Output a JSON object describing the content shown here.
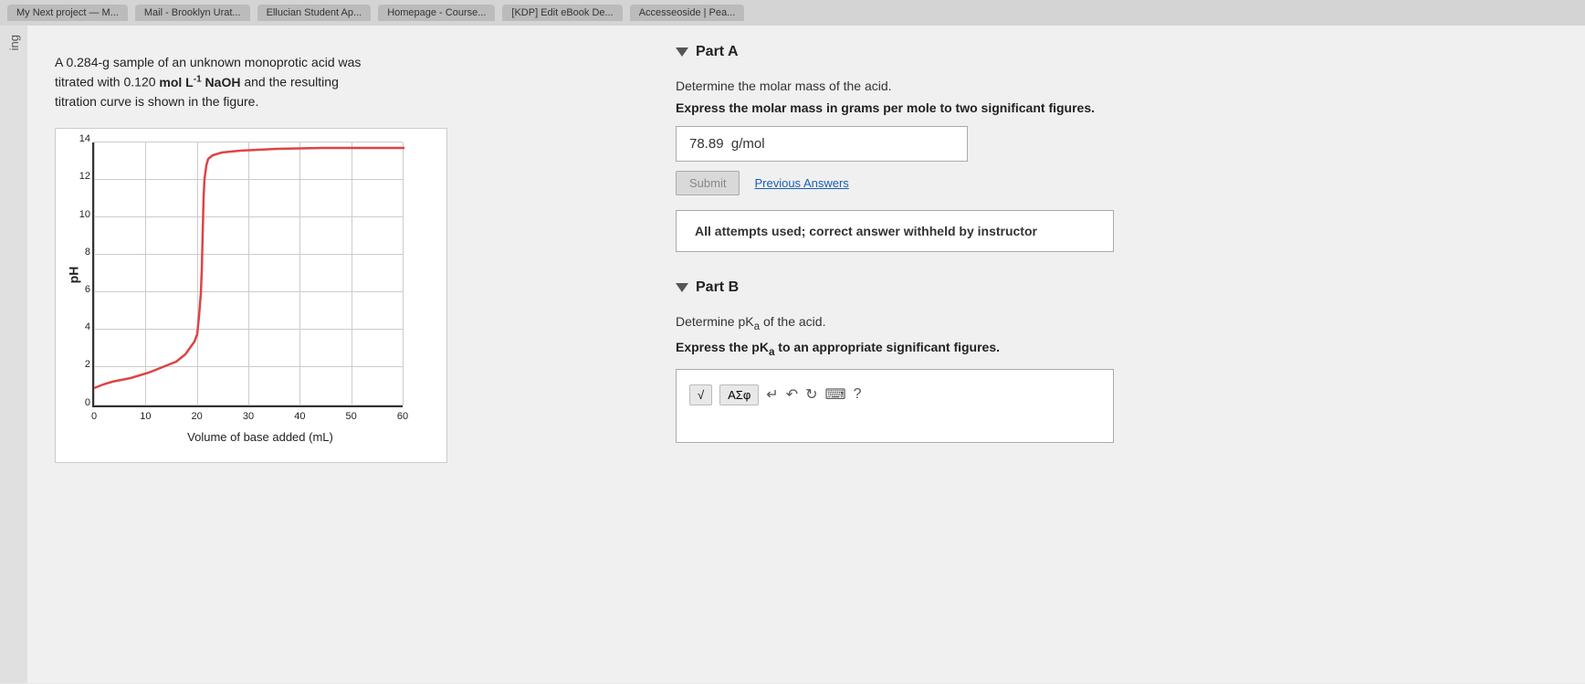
{
  "browser": {
    "tabs": [
      {
        "label": "My Next project — M...",
        "active": false
      },
      {
        "label": "Mail - Brooklyn Urat...",
        "active": false
      },
      {
        "label": "Ellucian Student Ap...",
        "active": false
      },
      {
        "label": "Homepage - Course...",
        "active": false
      },
      {
        "label": "[KDP] Edit eBook De...",
        "active": false
      },
      {
        "label": "Accesseoside | Pea...",
        "active": false
      }
    ]
  },
  "left_sidebar": {
    "text": "ing"
  },
  "problem": {
    "intro": "A 0.284-g sample of an unknown monoprotic acid was titrated with 0.120 mol L",
    "intro_sup": "-1",
    "intro_end": " NaOH and the resulting titration curve is shown in the figure.",
    "graph": {
      "y_label": "pH",
      "x_label": "Volume of base added (mL)",
      "y_ticks": [
        "0",
        "2",
        "4",
        "6",
        "8",
        "10",
        "12",
        "14"
      ],
      "x_ticks": [
        "0",
        "10",
        "20",
        "30",
        "40",
        "50",
        "60"
      ]
    }
  },
  "part_a": {
    "header": "Part A",
    "instruction": "Determine the molar mass of the acid.",
    "instruction_bold": "Express the molar mass in grams per mole to two significant figures.",
    "answer_value": "78.89  g/mol",
    "submit_label": "Submit",
    "previous_answers_label": "Previous Answers",
    "attempts_message": "All attempts used; correct answer withheld by instructor"
  },
  "part_b": {
    "header": "Part B",
    "instruction": "Determine pKₐ of the acid.",
    "instruction_bold": "Express the pKₐ to an appropriate significant figures.",
    "toolbar": {
      "sqrt_label": "√",
      "symbol_label": "AΣφ",
      "undo_label": "↵",
      "redo_label": "↶",
      "refresh_label": "↻",
      "keyboard_label": "⌨",
      "help_label": "?"
    }
  }
}
